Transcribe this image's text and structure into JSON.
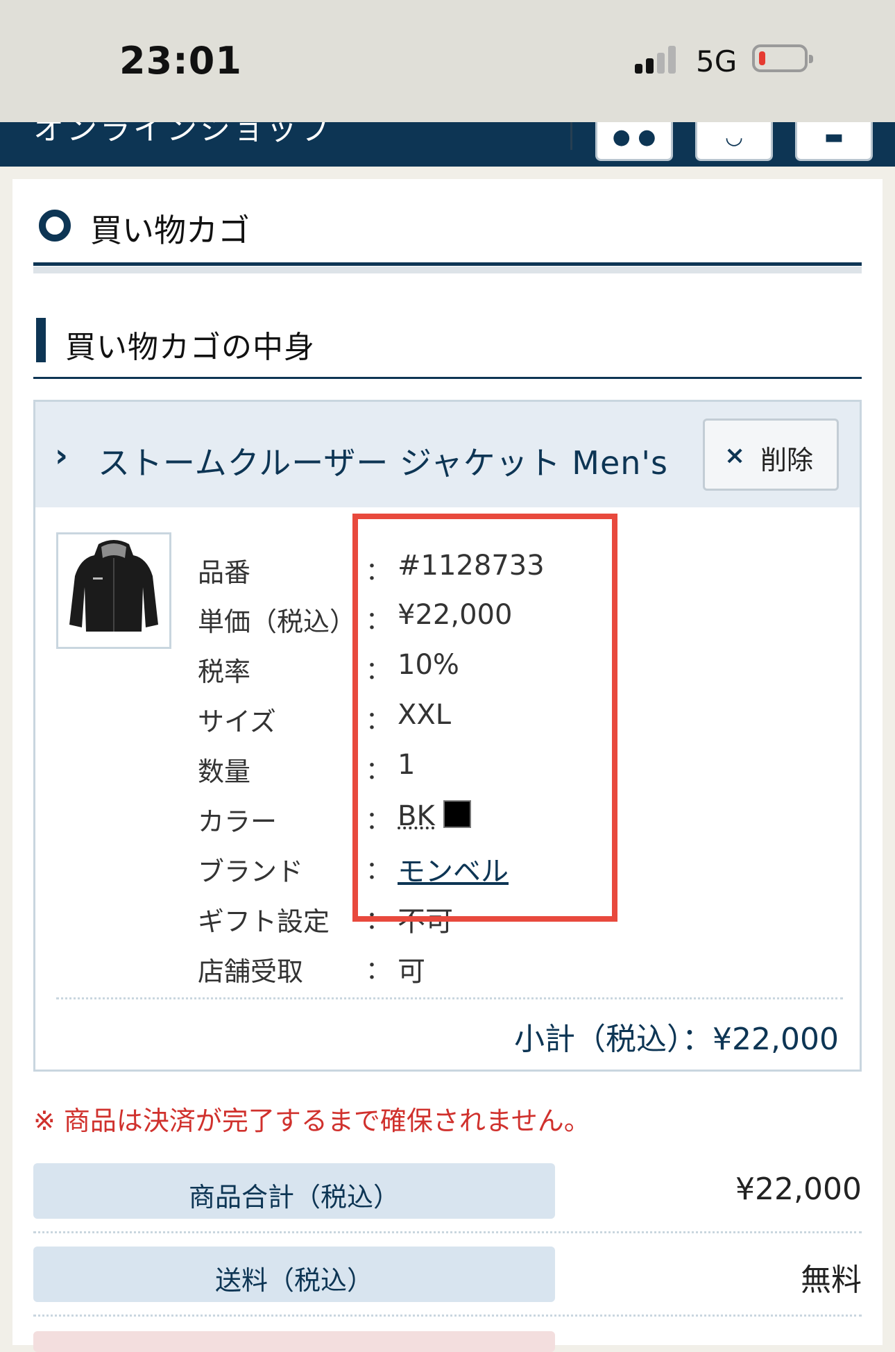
{
  "status_bar": {
    "time": "23:01",
    "network": "5G",
    "battery_color": "#e53b31"
  },
  "app_header": {
    "logo_fragment": "オンラインショップ",
    "cart_icon": "cart-icon",
    "search_icon": "search-icon",
    "menu_icon": "menu-icon"
  },
  "page": {
    "title": "買い物カゴ",
    "subtitle": "買い物カゴの中身"
  },
  "item": {
    "chevron": "›",
    "name": "ストームクルーザー ジャケット Men's",
    "delete_label": "削除",
    "delete_icon": "×",
    "image_icon": "jacket-image",
    "rows": [
      {
        "label": "品番",
        "colon": "：",
        "value": "#1128733"
      },
      {
        "label": "単価（税込）",
        "colon": "：",
        "value": "¥22,000"
      },
      {
        "label": "税率",
        "colon": "：",
        "value": "10%"
      },
      {
        "label": "サイズ",
        "colon": "：",
        "value": "XXL"
      },
      {
        "label": "数量",
        "colon": "：",
        "value": "1"
      },
      {
        "label": "カラー",
        "colon": "：",
        "value": "BK",
        "swatch_color": "#000000"
      },
      {
        "label": "ブランド",
        "colon": "：",
        "value": "モンベル"
      },
      {
        "label": "ギフト設定",
        "colon": "：",
        "value": "不可"
      },
      {
        "label": "店舗受取",
        "colon": "：",
        "value": "可"
      }
    ],
    "subtotal": "小計（税込）：¥22,000"
  },
  "notice": "※ 商品は決済が完了するまで確保されません。",
  "summary": [
    {
      "label": "商品合計（税込）",
      "value": "¥22,000"
    },
    {
      "label": "送料（税込）",
      "value": "無料"
    }
  ],
  "colors": {
    "brand_navy": "#0d3554",
    "highlight_red": "#e8493d",
    "label_bg": "#d8e4ef"
  }
}
